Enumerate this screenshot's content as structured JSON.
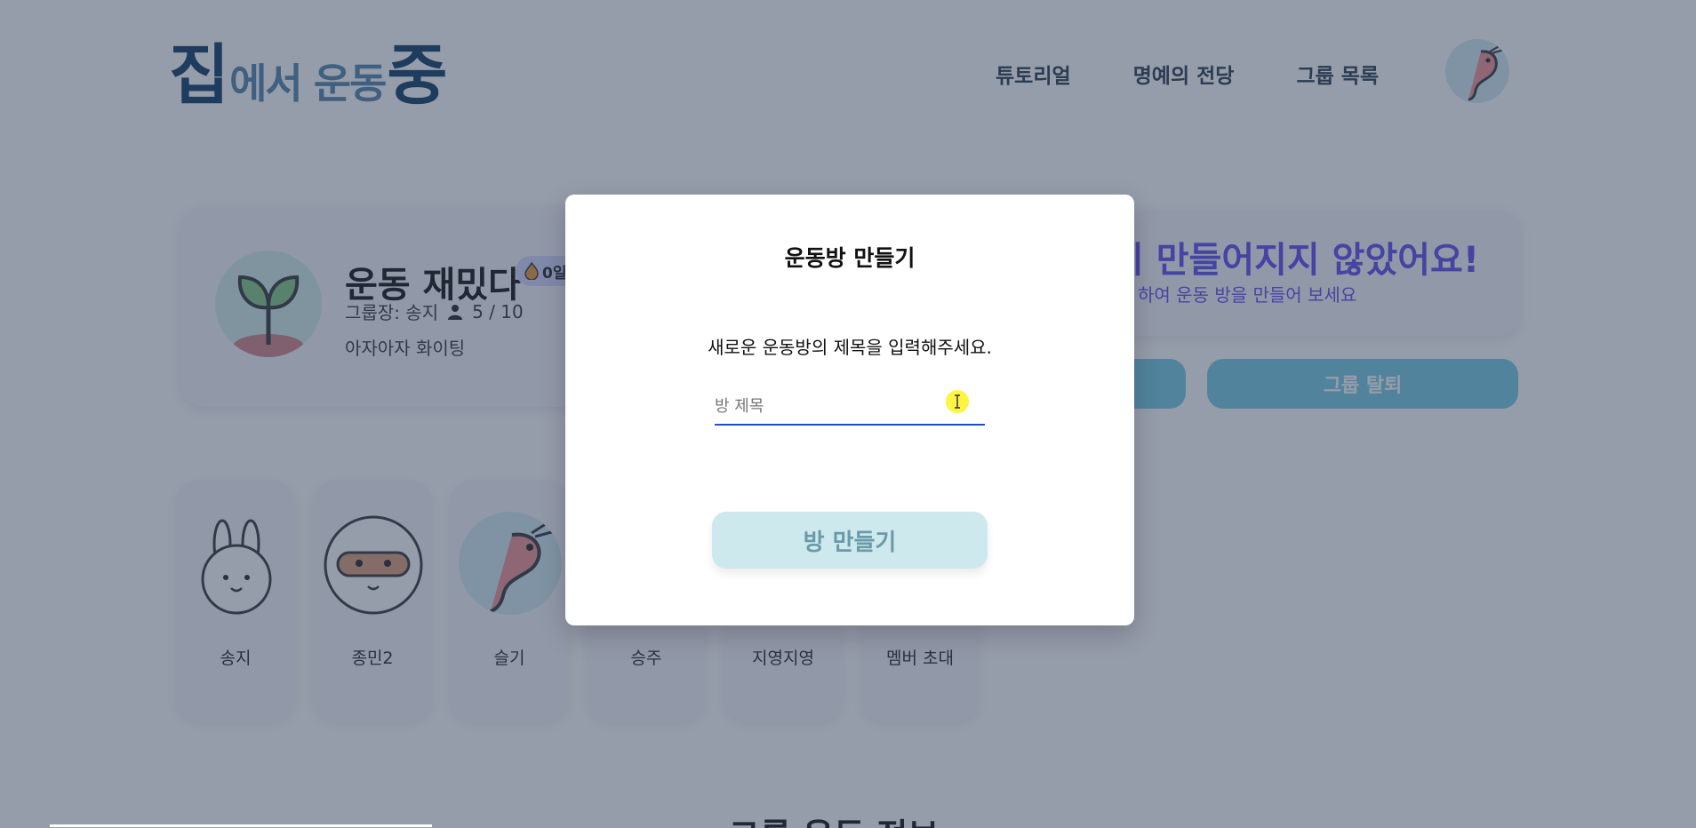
{
  "header": {
    "logo": {
      "part1": "집",
      "part2": "에서 운동",
      "part3": "중"
    },
    "nav": [
      "튜토리얼",
      "명예의 전당",
      "그룹 목록"
    ]
  },
  "group": {
    "name": "운동 재밌다",
    "streak": "0일",
    "leader": "그룹장: 송지",
    "members_count": "5 / 10",
    "description": "아자아자 화이팅"
  },
  "notice": {
    "title": "이 만들어지지 않았어요!",
    "subtitle": "하여 운동 방을 만들어 보세요"
  },
  "actions": {
    "leave_label": "그룹 탈퇴"
  },
  "members": [
    {
      "name": "송지",
      "avatar": "rabbit-icon"
    },
    {
      "name": "종민2",
      "avatar": "raccoon-icon"
    },
    {
      "name": "슬기",
      "avatar": "shrimp-icon"
    },
    {
      "name": "승주",
      "avatar": "none"
    },
    {
      "name": "지영지영",
      "avatar": "none"
    },
    {
      "name": "멤버 초대",
      "avatar": "none"
    }
  ],
  "section": {
    "title": "그룹 운동 정보"
  },
  "modal": {
    "title": "운동방 만들기",
    "description": "새로운 운동방의 제목을 입력해주세요.",
    "input_value": "",
    "input_placeholder": "방 제목",
    "submit_label": "방 만들기"
  },
  "colors": {
    "overlay": "#1e2d4b",
    "accent": "#6a5af0",
    "button": "#cde9ee",
    "input_underline": "#1a4fc2"
  }
}
